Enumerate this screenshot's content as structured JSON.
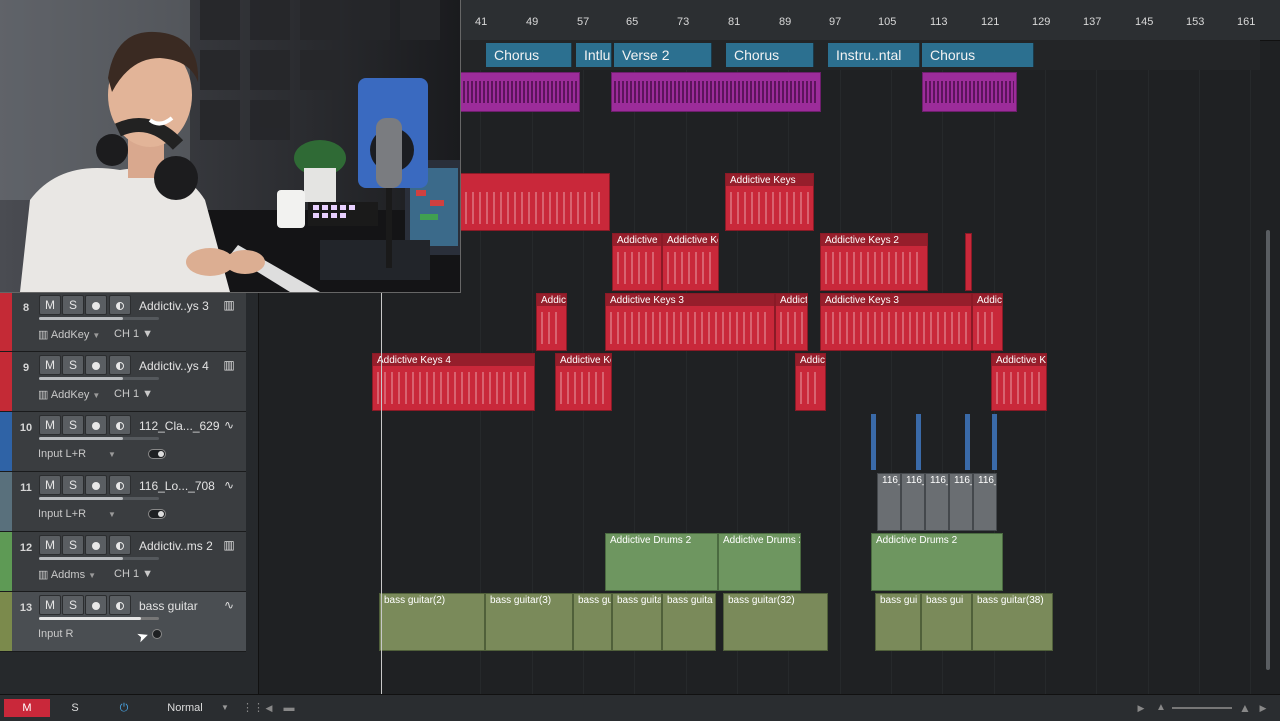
{
  "tracks": [
    {
      "num": "8",
      "name": "Addictiv..ys 3",
      "icon": "piano-icon",
      "io": "AddKey",
      "io2": "CH 1",
      "color": "#c42a36",
      "monitor": false
    },
    {
      "num": "9",
      "name": "Addictiv..ys 4",
      "icon": "piano-icon",
      "io": "AddKey",
      "io2": "CH 1",
      "color": "#c42a36",
      "monitor": false
    },
    {
      "num": "10",
      "name": "112_Cla..._629",
      "icon": "waveform-icon",
      "io": "Input L+R",
      "io2": "",
      "color": "#2f63a6",
      "monitor": true
    },
    {
      "num": "11",
      "name": "116_Lo..._708",
      "icon": "waveform-icon",
      "io": "Input L+R",
      "io2": "",
      "color": "#59707c",
      "monitor": true
    },
    {
      "num": "12",
      "name": "Addictiv..ms 2",
      "icon": "piano-icon",
      "io": "Addms",
      "io2": "CH 1",
      "color": "#5e9a55",
      "monitor": false
    },
    {
      "num": "13",
      "name": "bass guitar",
      "icon": "waveform-icon",
      "io": "Input R",
      "io2": "",
      "color": "#7b8a4c",
      "monitor": true
    }
  ],
  "buttons": {
    "mute": "M",
    "solo": "S"
  },
  "ruler": [
    "41",
    "49",
    "57",
    "65",
    "73",
    "81",
    "89",
    "97",
    "105",
    "113",
    "121",
    "129",
    "137",
    "145",
    "153",
    "161"
  ],
  "sections": [
    "Chorus",
    "Intlu",
    "Verse 2",
    "Chorus",
    "Instru..ntal",
    "Chorus"
  ],
  "events": {
    "keys_row1": [
      "Addictive Keys"
    ],
    "keys_row2": [
      "Addictive K",
      "Addictive Ke",
      "Addictive Keys 2"
    ],
    "keys_row3": [
      "Addict",
      "Addictive Keys 3",
      "Addict",
      "Addictive Keys 3",
      "Addict"
    ],
    "keys_row4": [
      "Addictive Keys 4",
      "Addictive Ke",
      "Addict",
      "Addictive Ke"
    ],
    "loops": [
      "116_",
      "116_",
      "116_",
      "116_",
      "116_"
    ],
    "drums": [
      "Addictive Drums 2",
      "Addictive Drums 2",
      "Addictive Drums 2"
    ],
    "bass": [
      "bass guitar(2)",
      "bass guitar(3)",
      "bass gu",
      "bass guita",
      "bass guita",
      "bass guitar(32)",
      "bass gui",
      "bass gui",
      "bass guitar(38)"
    ]
  },
  "bottombar": {
    "m": "M",
    "s": "S",
    "mode": "Normal"
  }
}
